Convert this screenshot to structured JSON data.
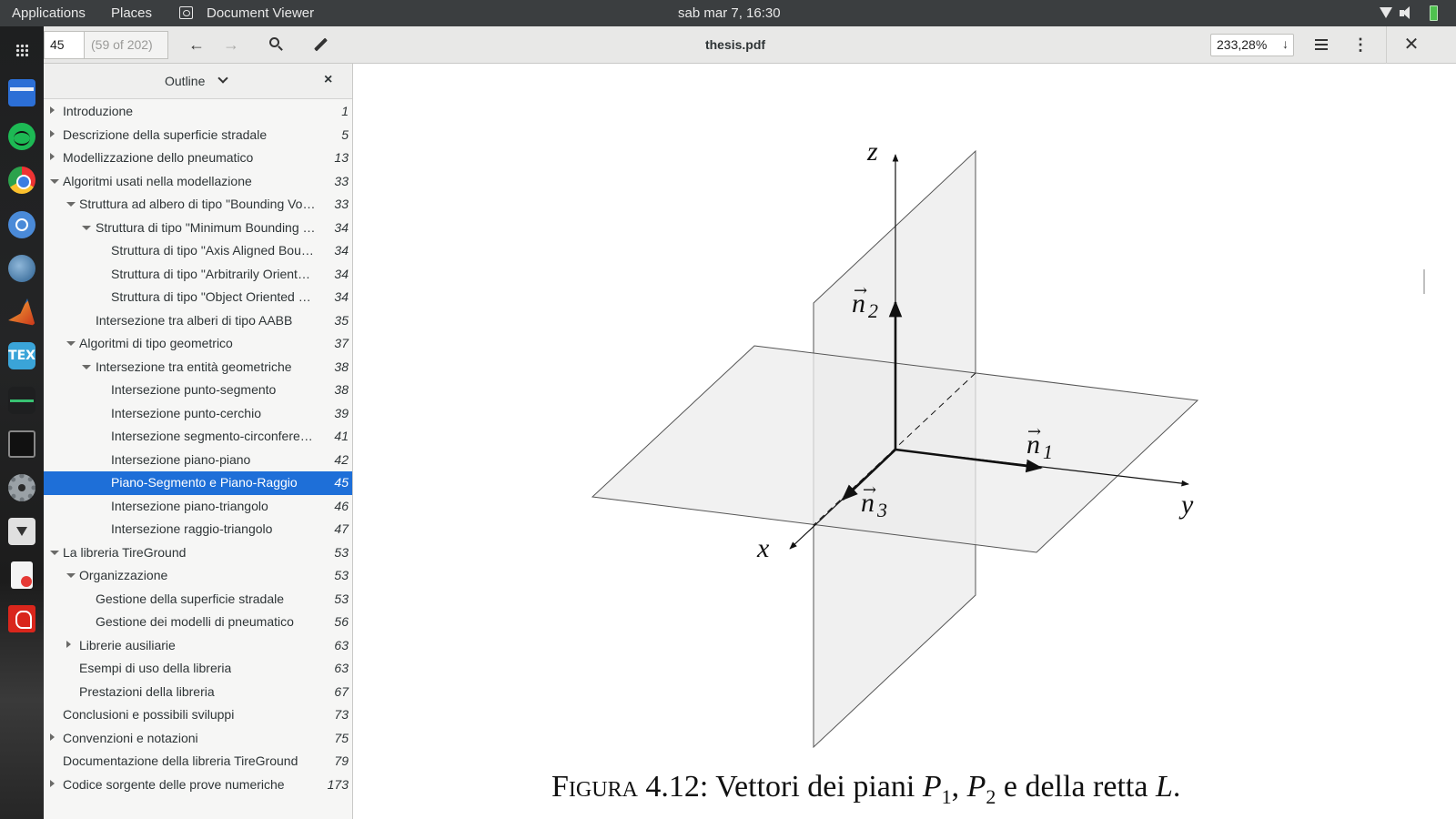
{
  "topbar": {
    "applications": "Applications",
    "places": "Places",
    "app_name": "Document Viewer",
    "clock": "sab mar  7, 16:30",
    "icons": [
      "document-viewer-icon",
      "wifi-icon",
      "volume-icon",
      "battery-icon"
    ]
  },
  "dock": {
    "icons": [
      "app-grid-icon",
      "files-icon",
      "spotify-icon",
      "chrome-icon",
      "chromium-icon",
      "thunderbird-icon",
      "matlab-icon",
      "texstudio-icon",
      "system-monitor-icon",
      "terminal-icon",
      "settings-icon",
      "software-install-icon",
      "document-viewer-icon",
      "acrobat-icon"
    ],
    "tex_label": "TEX"
  },
  "header": {
    "page_value": "45",
    "page_of": "(59 of 202)",
    "title": "thesis.pdf",
    "zoom": "233,28%",
    "icons": [
      "back-icon",
      "forward-icon",
      "search-icon",
      "annotate-icon",
      "menu-icon",
      "more-icon",
      "close-icon"
    ]
  },
  "sidebar": {
    "title": "Outline",
    "close": "×",
    "items": [
      {
        "label": "Introduzione",
        "page": "1",
        "level": 0,
        "expander": "collapsed"
      },
      {
        "label": "Descrizione della superficie stradale",
        "page": "5",
        "level": 0,
        "expander": "collapsed"
      },
      {
        "label": "Modellizzazione dello pneumatico",
        "page": "13",
        "level": 0,
        "expander": "collapsed"
      },
      {
        "label": "Algoritmi usati nella modellazione",
        "page": "33",
        "level": 0,
        "expander": "expanded"
      },
      {
        "label": "Struttura ad albero di tipo \"Bounding Vol…",
        "page": "33",
        "level": 1,
        "expander": "expanded"
      },
      {
        "label": "Struttura di tipo \"Minimum Bounding …",
        "page": "34",
        "level": 2,
        "expander": "expanded"
      },
      {
        "label": "Struttura di tipo \"Axis Aligned Bou…",
        "page": "34",
        "level": 3,
        "expander": "none"
      },
      {
        "label": "Struttura di tipo \"Arbitrarily Oriente…",
        "page": "34",
        "level": 3,
        "expander": "none"
      },
      {
        "label": "Struttura di tipo \"Object Oriented …",
        "page": "34",
        "level": 3,
        "expander": "none"
      },
      {
        "label": "Intersezione tra alberi di tipo AABB",
        "page": "35",
        "level": 2,
        "expander": "none"
      },
      {
        "label": "Algoritmi di tipo geometrico",
        "page": "37",
        "level": 1,
        "expander": "expanded"
      },
      {
        "label": "Intersezione tra entità geometriche",
        "page": "38",
        "level": 2,
        "expander": "expanded"
      },
      {
        "label": "Intersezione punto-segmento",
        "page": "38",
        "level": 3,
        "expander": "none"
      },
      {
        "label": "Intersezione punto-cerchio",
        "page": "39",
        "level": 3,
        "expander": "none"
      },
      {
        "label": "Intersezione segmento-circonfere…",
        "page": "41",
        "level": 3,
        "expander": "none"
      },
      {
        "label": "Intersezione piano-piano",
        "page": "42",
        "level": 3,
        "expander": "none"
      },
      {
        "label": "Piano-Segmento e Piano-Raggio",
        "page": "45",
        "level": 3,
        "expander": "none",
        "selected": true
      },
      {
        "label": "Intersezione piano-triangolo",
        "page": "46",
        "level": 3,
        "expander": "none"
      },
      {
        "label": "Intersezione raggio-triangolo",
        "page": "47",
        "level": 3,
        "expander": "none"
      },
      {
        "label": "La libreria TireGround",
        "page": "53",
        "level": 0,
        "expander": "expanded"
      },
      {
        "label": "Organizzazione",
        "page": "53",
        "level": 1,
        "expander": "expanded"
      },
      {
        "label": "Gestione della superficie stradale",
        "page": "53",
        "level": 2,
        "expander": "none"
      },
      {
        "label": "Gestione dei modelli di pneumatico",
        "page": "56",
        "level": 2,
        "expander": "none"
      },
      {
        "label": "Librerie ausiliarie",
        "page": "63",
        "level": 1,
        "expander": "collapsed"
      },
      {
        "label": "Esempi di uso della libreria",
        "page": "63",
        "level": 1,
        "expander": "none"
      },
      {
        "label": "Prestazioni della libreria",
        "page": "67",
        "level": 1,
        "expander": "none"
      },
      {
        "label": "Conclusioni e possibili sviluppi",
        "page": "73",
        "level": 0,
        "expander": "none"
      },
      {
        "label": "Convenzioni e notazioni",
        "page": "75",
        "level": 0,
        "expander": "collapsed"
      },
      {
        "label": "Documentazione della libreria TireGround",
        "page": "79",
        "level": 0,
        "expander": "none"
      },
      {
        "label": "Codice sorgente delle prove numeriche",
        "page": "173",
        "level": 0,
        "expander": "collapsed"
      }
    ]
  },
  "document": {
    "figure_labels": {
      "z": "z",
      "y": "y",
      "x": "x",
      "n1_base": "n",
      "n1_sub": "1",
      "n2_base": "n",
      "n2_sub": "2",
      "n3_base": "n",
      "n3_sub": "3"
    },
    "caption": {
      "prefix": "Figura 4.12:",
      "text": " Vettori dei piani ",
      "p1": "P",
      "p1_sub": "1",
      "sep": ", ",
      "p2": "P",
      "p2_sub": "2",
      "tail": " e della retta ",
      "l": "L",
      "end": "."
    }
  }
}
